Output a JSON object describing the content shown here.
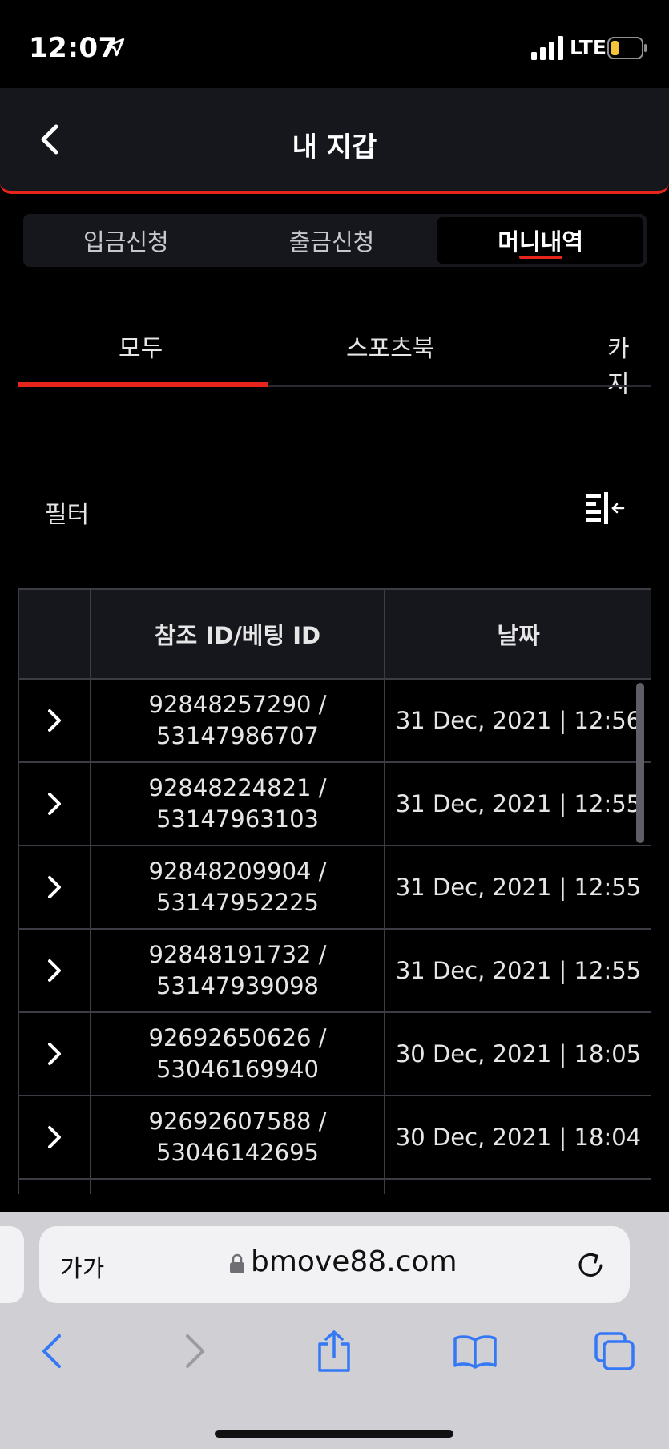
{
  "status_bar": {
    "time": "12:07",
    "network": "LTE"
  },
  "header": {
    "title": "내 지갑"
  },
  "wallet_tabs": [
    {
      "label": "입금신청",
      "active": false
    },
    {
      "label": "출금신청",
      "active": false
    },
    {
      "label": "머니내역",
      "active": true
    }
  ],
  "category_tabs": [
    {
      "label": "모두",
      "active": true
    },
    {
      "label": "스포츠북",
      "active": false
    },
    {
      "label": "카지",
      "active": false
    }
  ],
  "filter": {
    "label": "필터",
    "icon": "filter-columns-icon"
  },
  "table": {
    "headers": [
      "",
      "참조 ID/베팅 ID",
      "날짜"
    ],
    "rows": [
      {
        "ref_id": "92848257290 /",
        "bet_id": "53147986707",
        "date": "31 Dec, 2021 | 12:56"
      },
      {
        "ref_id": "92848224821 /",
        "bet_id": "53147963103",
        "date": "31 Dec, 2021 | 12:55"
      },
      {
        "ref_id": "92848209904 /",
        "bet_id": "53147952225",
        "date": "31 Dec, 2021 | 12:55"
      },
      {
        "ref_id": "92848191732 /",
        "bet_id": "53147939098",
        "date": "31 Dec, 2021 | 12:55"
      },
      {
        "ref_id": "92692650626 /",
        "bet_id": "53046169940",
        "date": "30 Dec, 2021 | 18:05"
      },
      {
        "ref_id": "92692607588 /",
        "bet_id": "53046142695",
        "date": "30 Dec, 2021 | 18:04"
      },
      {
        "ref_id": "",
        "bet_id": "",
        "date": ""
      }
    ]
  },
  "browser": {
    "aa_label": "가가",
    "url": "bmove88.com"
  },
  "colors": {
    "accent": "#e8251c",
    "header_bg": "#16171c",
    "browser_blue": "#3478f6"
  }
}
